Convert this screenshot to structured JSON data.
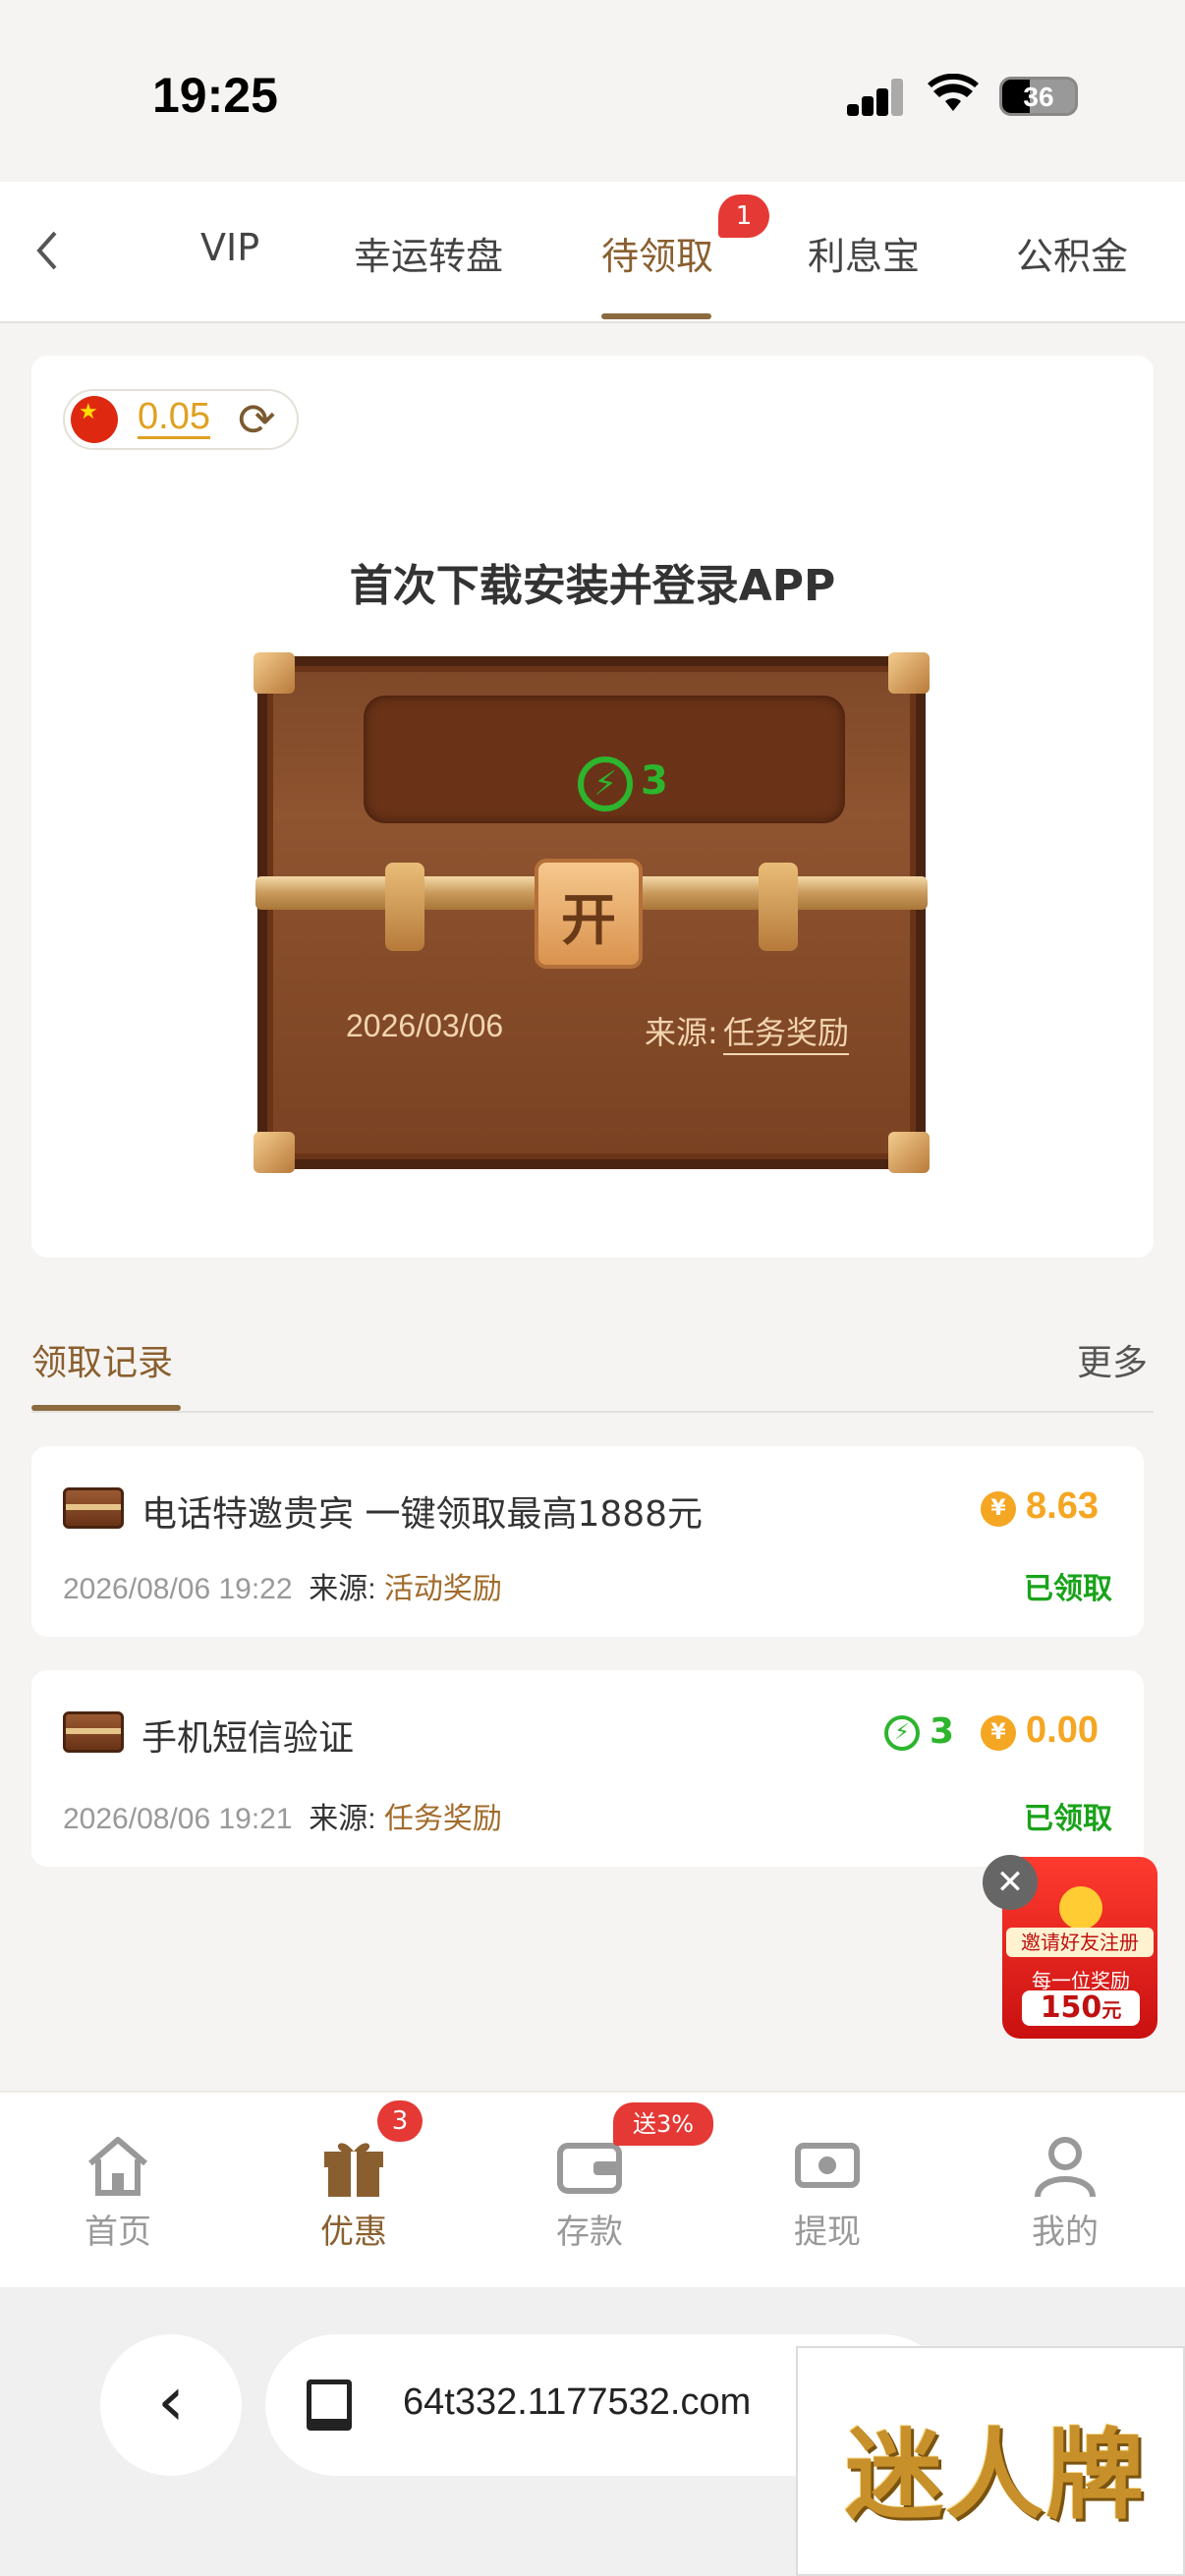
{
  "status_bar": {
    "time": "19:25",
    "battery": "36"
  },
  "tabs": {
    "back_icon": "chevron-left-icon",
    "items": [
      {
        "label": "VIP"
      },
      {
        "label": "幸运转盘"
      },
      {
        "label": "待领取",
        "badge": "1"
      },
      {
        "label": "利息宝"
      },
      {
        "label": "公积金"
      }
    ],
    "active": "待领取"
  },
  "balance": {
    "value": "0.05",
    "refresh_icon": "refresh-icon",
    "flag_icon": "china-flag-icon"
  },
  "task": {
    "title": "首次下载安装并登录APP",
    "energy": "3",
    "open_label": "开",
    "date": "2026/03/06",
    "source_label": "来源:",
    "source": "任务奖励"
  },
  "records": {
    "title": "领取记录",
    "more": "更多",
    "items": [
      {
        "name": "电话特邀贵宾 一键领取最高1888元",
        "time": "2026/08/06 19:22",
        "source_label": "来源:",
        "source": "活动奖励",
        "coin": "8.63",
        "status": "已领取",
        "coin_symbol": "¥"
      },
      {
        "name": "手机短信验证",
        "time": "2026/08/06 19:21",
        "source_label": "来源:",
        "source": "任务奖励",
        "energy": "3",
        "coin": "0.00",
        "status": "已领取",
        "coin_symbol": "¥"
      }
    ]
  },
  "promo": {
    "line1": "邀请好友注册",
    "line2": "每一位奖励",
    "amount": "150",
    "unit": "元",
    "close": "✕"
  },
  "bottom_nav": {
    "items": [
      {
        "label": "首页",
        "icon": "home-icon"
      },
      {
        "label": "优惠",
        "icon": "gift-icon",
        "badge": "3"
      },
      {
        "label": "存款",
        "icon": "wallet-icon",
        "badge": "送3%"
      },
      {
        "label": "提现",
        "icon": "cash-icon"
      },
      {
        "label": "我的",
        "icon": "user-icon"
      }
    ],
    "active": "优惠"
  },
  "browser": {
    "url": "64t332.1177532.com",
    "watermark": "迷人牌"
  },
  "colors": {
    "accent": "#8a5f2f",
    "green": "#2db52d",
    "gold": "#f5a623",
    "red": "#e53935"
  }
}
